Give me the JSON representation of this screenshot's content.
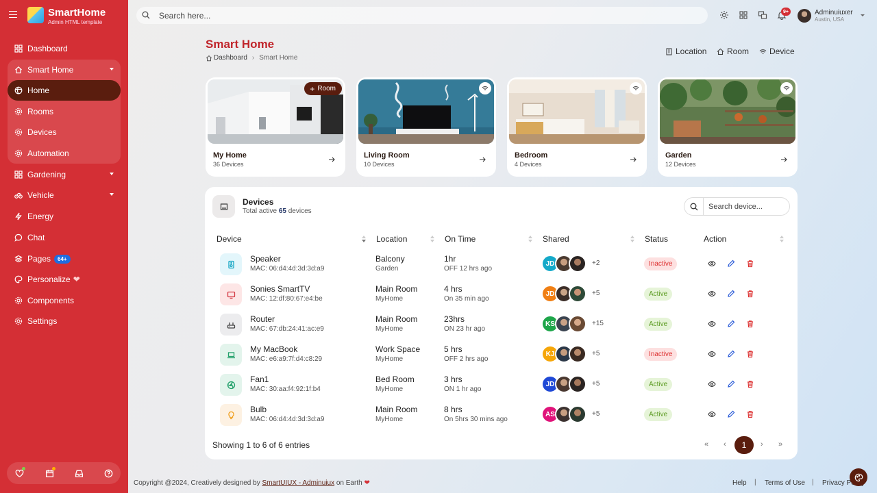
{
  "brand": {
    "name": "SmartHome",
    "subtitle": "Admin HTML template"
  },
  "sidebar": {
    "items": [
      {
        "label": "Dashboard",
        "icon": "grid-icon"
      },
      {
        "label": "Smart Home",
        "icon": "home-icon"
      },
      {
        "label": "Home",
        "icon": "globe-icon"
      },
      {
        "label": "Rooms",
        "icon": "gear-icon"
      },
      {
        "label": "Devices",
        "icon": "gear-icon"
      },
      {
        "label": "Automation",
        "icon": "gear-icon"
      },
      {
        "label": "Gardening",
        "icon": "leaf-icon"
      },
      {
        "label": "Vehicle",
        "icon": "bicycle-icon"
      },
      {
        "label": "Energy",
        "icon": "lightning-icon"
      },
      {
        "label": "Chat",
        "icon": "chat-icon"
      },
      {
        "label": "Pages",
        "icon": "layers-icon",
        "badge": "64+"
      },
      {
        "label": "Personalize",
        "icon": "palette-icon"
      },
      {
        "label": "Components",
        "icon": "gear-icon"
      },
      {
        "label": "Settings",
        "icon": "gear-icon"
      }
    ]
  },
  "search": {
    "placeholder": "Search here..."
  },
  "notifications": {
    "badge": "9+"
  },
  "user": {
    "name": "Adminuiuxer",
    "location": "Austin, USA"
  },
  "page": {
    "title": "Smart Home",
    "breadcrumb": [
      "Dashboard",
      "Smart Home"
    ]
  },
  "quick_links": [
    "Location",
    "Room",
    "Device"
  ],
  "rooms": [
    {
      "name": "My Home",
      "count": "36 Devices",
      "button": "Room"
    },
    {
      "name": "Living Room",
      "count": "10 Devices"
    },
    {
      "name": "Bedroom",
      "count": "4 Devices"
    },
    {
      "name": "Garden",
      "count": "12 Devices"
    }
  ],
  "devices_panel": {
    "title": "Devices",
    "subtitle_prefix": "Total active",
    "active_count": "65",
    "subtitle_suffix": "devices",
    "search_placeholder": "Search device...",
    "columns": [
      "Device",
      "Location",
      "On Time",
      "Shared",
      "Status",
      "Action"
    ],
    "rows": [
      {
        "name": "Speaker",
        "mac": "MAC: 06:d4:4d:3d:3d:a9",
        "location": "Balcony",
        "place": "Garden",
        "time": "1hr",
        "since": "OFF 12 hrs ago",
        "initials": "JD",
        "more": "+2",
        "status": "Inactive"
      },
      {
        "name": "Sonies SmartTV",
        "mac": "MAC: 12:df:80:67:e4:be",
        "location": "Main Room",
        "place": "MyHome",
        "time": "4 hrs",
        "since": "On 35 min ago",
        "initials": "JD",
        "more": "+5",
        "status": "Active"
      },
      {
        "name": "Router",
        "mac": "MAC: 67:db:24:41:ac:e9",
        "location": "Main Room",
        "place": "MyHome",
        "time": "23hrs",
        "since": "ON 23 hr ago",
        "initials": "KS",
        "more": "+15",
        "status": "Active"
      },
      {
        "name": "My MacBook",
        "mac": "MAC: e6:a9:7f:d4:c8:29",
        "location": "Work Space",
        "place": "MyHome",
        "time": "5 hrs",
        "since": "OFF 2 hrs ago",
        "initials": "KJ",
        "more": "+5",
        "status": "Inactive"
      },
      {
        "name": "Fan1",
        "mac": "MAC: 30:aa:f4:92:1f:b4",
        "location": "Bed Room",
        "place": "MyHome",
        "time": "3 hrs",
        "since": "ON 1 hr ago",
        "initials": "JD",
        "more": "+5",
        "status": "Active"
      },
      {
        "name": "Bulb",
        "mac": "MAC: 06:d4:4d:3d:3d:a9",
        "location": "Main Room",
        "place": "MyHome",
        "time": "8 hrs",
        "since": "On 5hrs 30 mins ago",
        "initials": "AS",
        "more": "+5",
        "status": "Active"
      }
    ],
    "showing": "Showing 1 to 6 of 6 entries",
    "pagination": {
      "first": "«",
      "prev": "‹",
      "current": "1",
      "next": "›",
      "last": "»"
    }
  },
  "footer": {
    "copyright": "Copyright @2024, Creatively designed by",
    "link": "SmartUIUX - Adminuiux",
    "suffix": "on Earth",
    "links": [
      "Help",
      "Terms of Use",
      "Privacy Policy"
    ]
  },
  "colors": {
    "brand_red": "#d42f35",
    "dark_brown": "#5a1d0e",
    "active_green": "#5a9a20",
    "inactive_red": "#d33"
  }
}
